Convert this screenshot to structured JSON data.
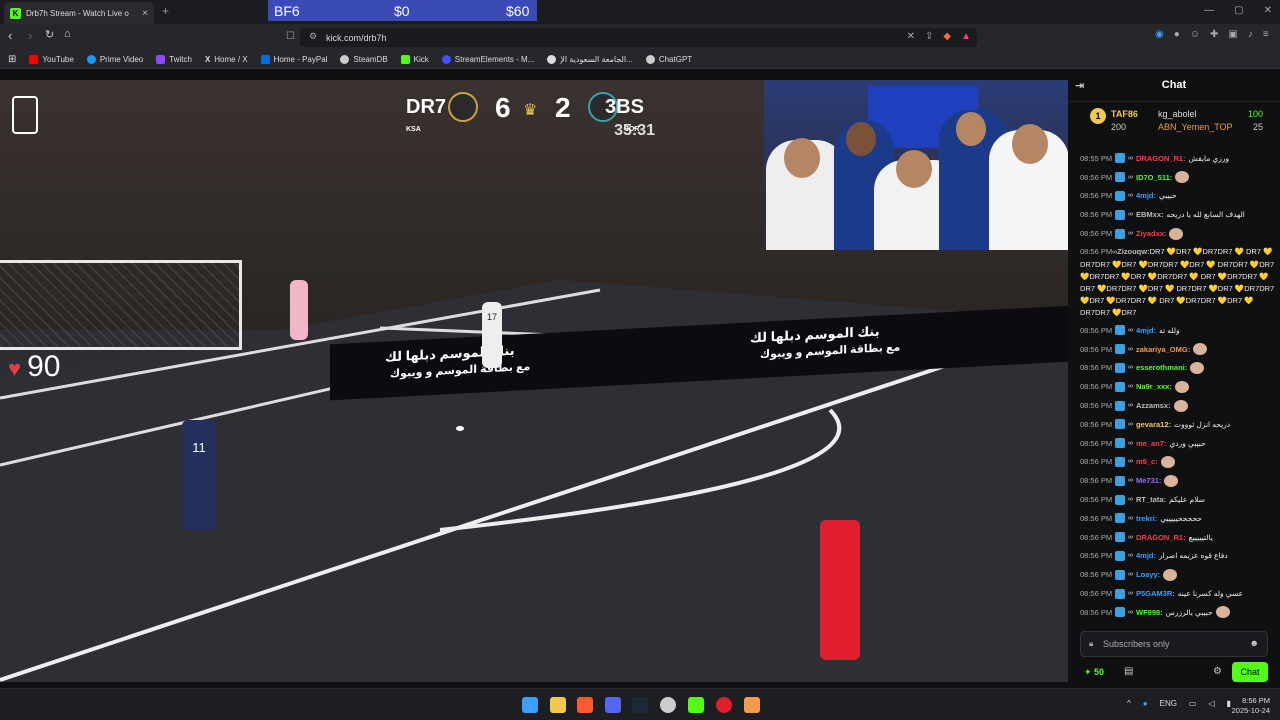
{
  "tab": {
    "title": "Drb7h Stream - Watch Live o",
    "favicon_letter": "K",
    "new_tab": "+",
    "close": "×"
  },
  "overlay": {
    "game": "BF6",
    "price1": "$0",
    "price2": "$60"
  },
  "window_controls": {
    "min": "—",
    "max": "▢",
    "close": "✕"
  },
  "address": {
    "url": "kick.com/drb7h"
  },
  "bookmarks": [
    {
      "label": "YouTube",
      "color": "#ff0000"
    },
    {
      "label": "Prime Video",
      "color": "#1a98ff"
    },
    {
      "label": "Twitch",
      "color": "#9146ff"
    },
    {
      "label": "Home / X",
      "color": "#ffffff"
    },
    {
      "label": "Home - PayPal",
      "color": "#0070e0"
    },
    {
      "label": "SteamDB",
      "color": "#cccccc"
    },
    {
      "label": "Kick",
      "color": "#53fc18"
    },
    {
      "label": "StreamElements - M...",
      "color": "#4050ff"
    },
    {
      "label": "الجامعة السعودية الإ...",
      "color": "#dddddd"
    },
    {
      "label": "ChatGPT",
      "color": "#cccccc"
    }
  ],
  "scoreboard": {
    "team1": "DR7",
    "team2": "3BS",
    "score1": "6",
    "score2": "2",
    "clock": "35:31",
    "country1": "KSA",
    "country2": "JOR"
  },
  "heart_rate": "90",
  "ads": {
    "line1": "بنك الموسم دبلها لك",
    "line2": "مع بطاقة الموسم و ويبوك"
  },
  "players": {
    "p1": "17",
    "p2": "11"
  },
  "chat": {
    "title": "Chat",
    "leaderboard": [
      {
        "rank": "1",
        "name": "TAF86",
        "points": "200"
      },
      {
        "name": "kg_abolel",
        "points": "100"
      },
      {
        "name": "ABN_Yemen_TOP",
        "points": "25"
      }
    ],
    "messages": [
      {
        "time": "08:55 PM",
        "user": "DRAGON_R1:",
        "text": "ورزي مايفش",
        "color": "#ff3b4a"
      },
      {
        "time": "08:56 PM",
        "user": "ID7O_511:",
        "text": "",
        "color": "#53fc18",
        "emote": true
      },
      {
        "time": "08:56 PM",
        "user": "4mjd:",
        "text": "حبيبي",
        "color": "#3aa0ff"
      },
      {
        "time": "08:56 PM",
        "user": "EBMxx:",
        "text": "الهدف السابع لله يا دريحه",
        "color": "#bbbbbb"
      },
      {
        "time": "08:56 PM",
        "user": "Ziyadxx:",
        "text": "",
        "color": "#ff3b4a",
        "emote": true
      },
      {
        "time": "08:56 PM",
        "user": "Zizouqw:",
        "text": "DR7 💛DR7 💛DR7DR7 💛 DR7 💛DR7DR7 💛DR7 💛DR7DR7 💛DR7 💛 DR7DR7 💛DR7 💛DR7DR7 💛DR7 💛DR7DR7 💛 DR7 💛DR7DR7 💛DR7 💛DR7DR7 💛DR7 💛 DR7DR7 💛DR7 💛DR7DR7 💛DR7 💛DR7DR7 💛 DR7 💛DR7DR7 💛DR7 💛DR7DR7 💛DR7",
        "color": "#bbbbbb",
        "multi": true
      },
      {
        "time": "08:56 PM",
        "user": "4mjd:",
        "text": "ولله ته",
        "color": "#3aa0ff"
      },
      {
        "time": "08:56 PM",
        "user": "zakariya_OMG:",
        "text": "",
        "color": "#f2994a",
        "emote": true
      },
      {
        "time": "08:56 PM",
        "user": "esserothmani:",
        "text": "",
        "color": "#53fc18",
        "emote": true
      },
      {
        "time": "08:56 PM",
        "user": "Na9r_xxx:",
        "text": "",
        "color": "#53fc18",
        "emote": true
      },
      {
        "time": "08:56 PM",
        "user": "Azzamsx:",
        "text": "",
        "color": "#bbbbbb",
        "emote": true
      },
      {
        "time": "08:56 PM",
        "user": "gevara12:",
        "text": "دريحه انزل ثوووت",
        "color": "#f2c94c"
      },
      {
        "time": "08:56 PM",
        "user": "me_an7:",
        "text": "حبيبي وردي",
        "color": "#ff3b4a"
      },
      {
        "time": "08:56 PM",
        "user": "m9_c:",
        "text": "",
        "color": "#ff3b4a",
        "emote": true
      },
      {
        "time": "08:56 PM",
        "user": "Me731:",
        "text": "",
        "color": "#9b6bff",
        "emote": true
      },
      {
        "time": "08:56 PM",
        "user": "RT_tata:",
        "text": "سلام عليكم",
        "color": "#bbbbbb"
      },
      {
        "time": "08:56 PM",
        "user": "trekri:",
        "text": "حححححيييييي",
        "color": "#3aa0ff"
      },
      {
        "time": "08:56 PM",
        "user": "DRAGON_R1:",
        "text": "يالتيييييع",
        "color": "#ff3b4a"
      },
      {
        "time": "08:56 PM",
        "user": "4mjd:",
        "text": "دفاع قوه عزيمه اصرار",
        "color": "#3aa0ff"
      },
      {
        "time": "08:56 PM",
        "user": "Loayy:",
        "text": "",
        "color": "#3aa0ff",
        "emote": true
      },
      {
        "time": "08:56 PM",
        "user": "P5GAM3R:",
        "text": "عسي وله كسرنا عينه",
        "color": "#3aa0ff"
      },
      {
        "time": "08:56 PM",
        "user": "WF998:",
        "text": "حبيبي يالرزرس",
        "color": "#53fc18",
        "emote": true
      }
    ],
    "input_placeholder": "Subscribers only",
    "points": "50",
    "send_label": "Chat"
  },
  "taskbar": {
    "lang": "ENG",
    "time": "8:56 PM",
    "date": "2025-10-24"
  }
}
